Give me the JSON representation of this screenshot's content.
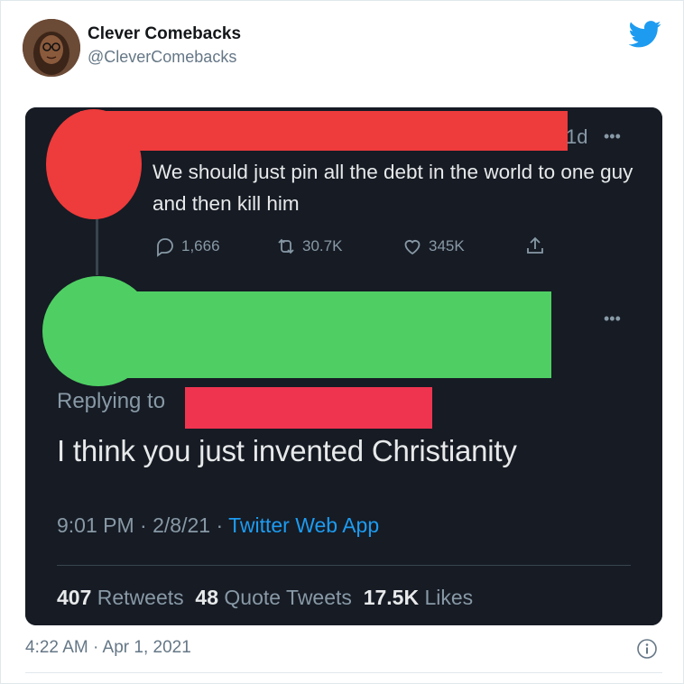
{
  "author": {
    "display_name": "Clever Comebacks",
    "handle": "@CleverComebacks"
  },
  "icons": {
    "brand": "twitter-bird-icon",
    "info": "info-icon",
    "more": "more-horizontal-icon",
    "reply": "reply-icon",
    "retweet": "retweet-icon",
    "like": "heart-icon",
    "share": "share-icon"
  },
  "colors": {
    "twitter_blue": "#1d9bf0",
    "dark_bg": "#161b24",
    "redact_red": "#ee3b3b",
    "redact_green": "#4fcf63",
    "redact_pink": "#ef3450"
  },
  "screenshot": {
    "original_tweet": {
      "time_ago": "1d",
      "text": "We should just pin all the debt in the world to one guy and then kill him",
      "replies": "1,666",
      "retweets": "30.7K",
      "likes": "345K"
    },
    "reply": {
      "replying_to_label": "Replying to",
      "text": "I think you just invented Christianity",
      "time": "9:01 PM",
      "date": "2/8/21",
      "app": "Twitter Web App",
      "retweets_count": "407",
      "retweets_label": "Retweets",
      "quote_count": "48",
      "quote_label": "Quote Tweets",
      "likes_count": "17.5K",
      "likes_label": "Likes"
    }
  },
  "footer": {
    "timestamp": "4:22 AM · Apr 1, 2021"
  }
}
